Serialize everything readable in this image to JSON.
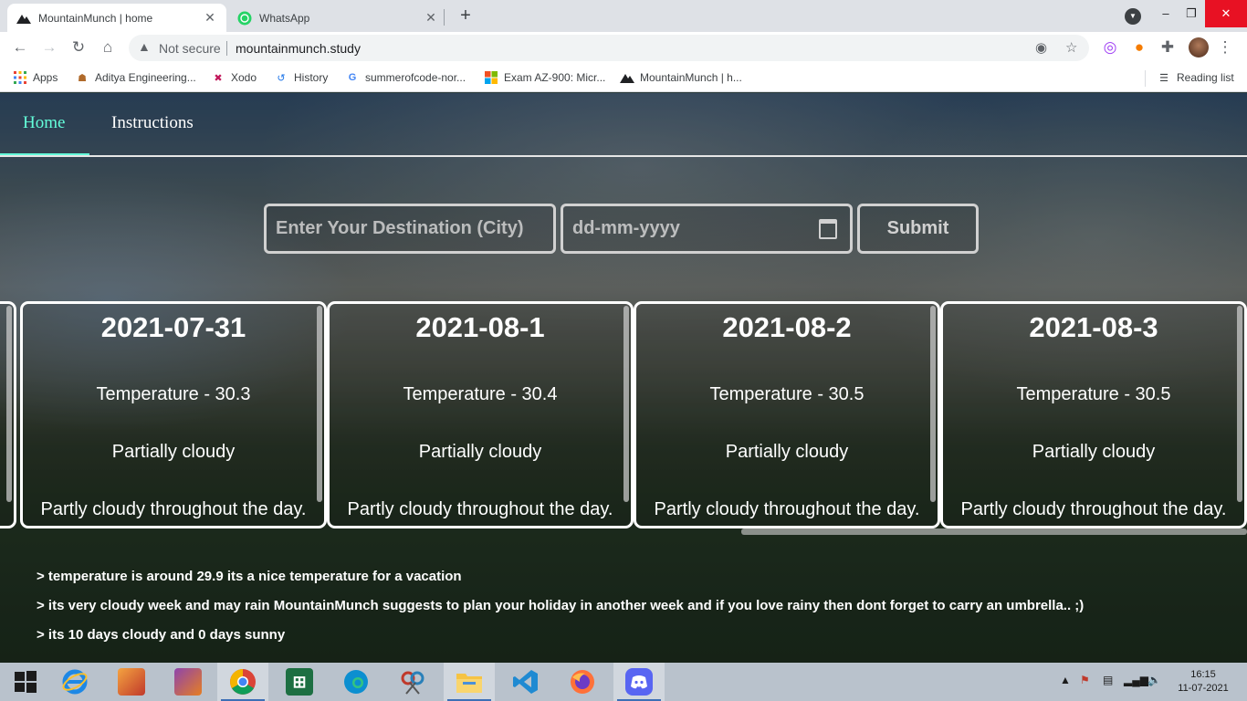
{
  "browser": {
    "tabs": [
      {
        "title": "MountainMunch | home",
        "icon": "mountain-icon",
        "active": true
      },
      {
        "title": "WhatsApp",
        "icon": "whatsapp-icon",
        "active": false
      }
    ],
    "new_tab": "+",
    "window_controls": {
      "minimize": "–",
      "maximize": "❐",
      "close": "✕"
    },
    "address_bar": {
      "security_label": "Not secure",
      "url": "mountainmunch.study"
    },
    "bookmarks": [
      {
        "label": "Apps",
        "icon": "apps-grid-icon"
      },
      {
        "label": "Aditya Engineering...",
        "icon": "college-icon"
      },
      {
        "label": "Xodo",
        "icon": "xodo-icon"
      },
      {
        "label": "History",
        "icon": "history-icon"
      },
      {
        "label": "summerofcode-nor...",
        "icon": "google-icon"
      },
      {
        "label": "Exam AZ-900: Micr...",
        "icon": "microsoft-icon"
      },
      {
        "label": "MountainMunch | h...",
        "icon": "mountain-icon"
      }
    ],
    "reading_list": "Reading list"
  },
  "site": {
    "nav": {
      "home": "Home",
      "instructions": "Instructions"
    },
    "search": {
      "destination_placeholder": "Enter Your Destination (City)",
      "date_placeholder": "dd-mm-yyyy",
      "submit_label": "Submit"
    },
    "forecast": [
      {
        "date": "2021-07-31",
        "temperature": "Temperature - 30.3",
        "condition": "Partially cloudy",
        "description": "Partly cloudy throughout the day."
      },
      {
        "date": "2021-08-1",
        "temperature": "Temperature - 30.4",
        "condition": "Partially cloudy",
        "description": "Partly cloudy throughout the day."
      },
      {
        "date": "2021-08-2",
        "temperature": "Temperature - 30.5",
        "condition": "Partially cloudy",
        "description": "Partly cloudy throughout the day."
      },
      {
        "date": "2021-08-3",
        "temperature": "Temperature - 30.5",
        "condition": "Partially cloudy",
        "description": "Partly cloudy throughout the day."
      }
    ],
    "notes": [
      "> temperature is around 29.9 its a nice temperature for a vacation",
      "> its very cloudy week and may rain MountainMunch suggests to plan your holiday in another week and if you love rainy then dont forget to carry an umbrella.. ;)",
      "> its 10 days cloudy and 0 days sunny"
    ]
  },
  "taskbar": {
    "apps": [
      {
        "name": "start-button"
      },
      {
        "name": "internet-explorer-icon"
      },
      {
        "name": "app-icon"
      },
      {
        "name": "winrar-icon"
      },
      {
        "name": "chrome-icon",
        "open": true
      },
      {
        "name": "excel-icon"
      },
      {
        "name": "edge-icon"
      },
      {
        "name": "snipping-tool-icon"
      },
      {
        "name": "file-explorer-icon",
        "open": true
      },
      {
        "name": "vscode-icon"
      },
      {
        "name": "firefox-icon"
      },
      {
        "name": "discord-icon",
        "open": true
      }
    ],
    "time": "16:15",
    "date": "11-07-2021"
  }
}
